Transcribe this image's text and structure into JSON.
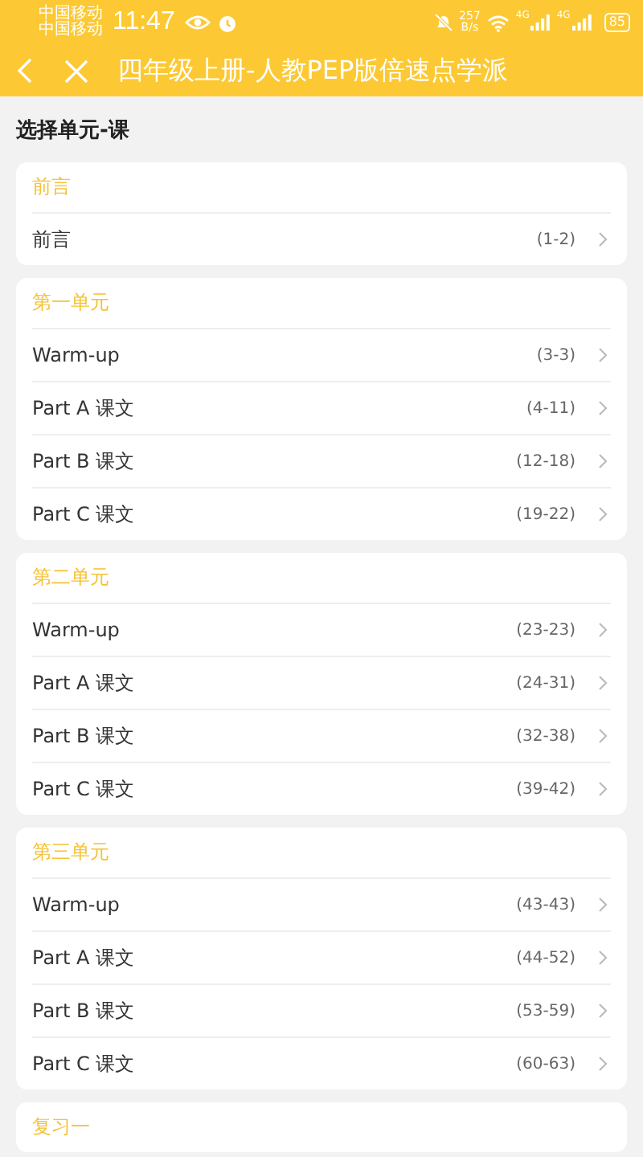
{
  "status_bar": {
    "carriers": [
      "中国移动",
      "中国移动"
    ],
    "time": "11:47",
    "net_speed": "257",
    "net_unit": "B/s",
    "network_labels": [
      "4G",
      "4G"
    ],
    "battery": "85"
  },
  "header": {
    "title": "四年级上册-人教PEP版倍速点学派"
  },
  "page_title": "选择单元-课",
  "units": [
    {
      "title": "前言",
      "lessons": [
        {
          "name": "前言",
          "pages": "(1-2)"
        }
      ]
    },
    {
      "title": "第一单元",
      "lessons": [
        {
          "name": "Warm-up",
          "pages": "(3-3)"
        },
        {
          "name": "Part A 课文",
          "pages": "(4-11)"
        },
        {
          "name": "Part B 课文",
          "pages": "(12-18)"
        },
        {
          "name": "Part C 课文",
          "pages": "(19-22)"
        }
      ]
    },
    {
      "title": "第二单元",
      "lessons": [
        {
          "name": "Warm-up",
          "pages": "(23-23)"
        },
        {
          "name": "Part A 课文",
          "pages": "(24-31)"
        },
        {
          "name": "Part B 课文",
          "pages": "(32-38)"
        },
        {
          "name": "Part C 课文",
          "pages": "(39-42)"
        }
      ]
    },
    {
      "title": "第三单元",
      "lessons": [
        {
          "name": "Warm-up",
          "pages": "(43-43)"
        },
        {
          "name": "Part A 课文",
          "pages": "(44-52)"
        },
        {
          "name": "Part B 课文",
          "pages": "(53-59)"
        },
        {
          "name": "Part C 课文",
          "pages": "(60-63)"
        }
      ]
    },
    {
      "title": "复习一"
    }
  ]
}
